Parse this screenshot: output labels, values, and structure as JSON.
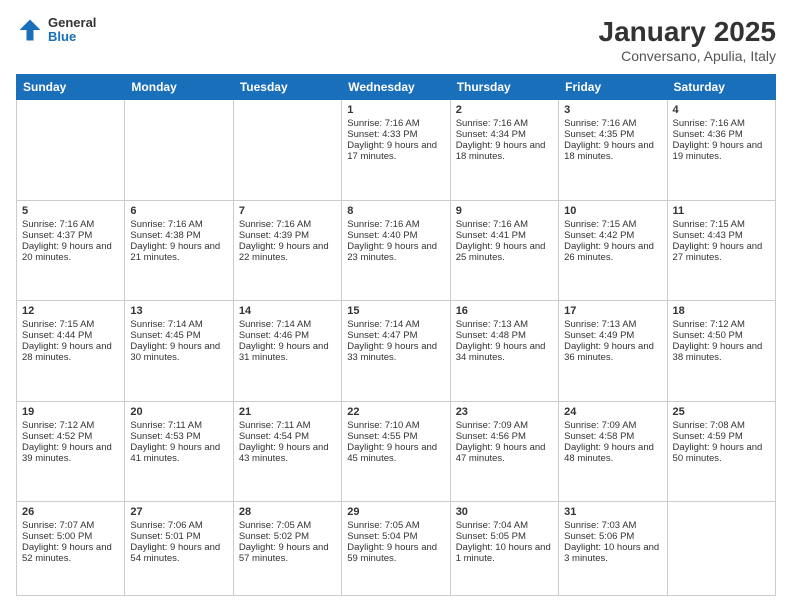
{
  "header": {
    "logo": {
      "general": "General",
      "blue": "Blue"
    },
    "title": "January 2025",
    "subtitle": "Conversano, Apulia, Italy"
  },
  "weekdays": [
    "Sunday",
    "Monday",
    "Tuesday",
    "Wednesday",
    "Thursday",
    "Friday",
    "Saturday"
  ],
  "weeks": [
    [
      {
        "day": "",
        "sunrise": "",
        "sunset": "",
        "daylight": ""
      },
      {
        "day": "",
        "sunrise": "",
        "sunset": "",
        "daylight": ""
      },
      {
        "day": "",
        "sunrise": "",
        "sunset": "",
        "daylight": ""
      },
      {
        "day": "1",
        "sunrise": "Sunrise: 7:16 AM",
        "sunset": "Sunset: 4:33 PM",
        "daylight": "Daylight: 9 hours and 17 minutes."
      },
      {
        "day": "2",
        "sunrise": "Sunrise: 7:16 AM",
        "sunset": "Sunset: 4:34 PM",
        "daylight": "Daylight: 9 hours and 18 minutes."
      },
      {
        "day": "3",
        "sunrise": "Sunrise: 7:16 AM",
        "sunset": "Sunset: 4:35 PM",
        "daylight": "Daylight: 9 hours and 18 minutes."
      },
      {
        "day": "4",
        "sunrise": "Sunrise: 7:16 AM",
        "sunset": "Sunset: 4:36 PM",
        "daylight": "Daylight: 9 hours and 19 minutes."
      }
    ],
    [
      {
        "day": "5",
        "sunrise": "Sunrise: 7:16 AM",
        "sunset": "Sunset: 4:37 PM",
        "daylight": "Daylight: 9 hours and 20 minutes."
      },
      {
        "day": "6",
        "sunrise": "Sunrise: 7:16 AM",
        "sunset": "Sunset: 4:38 PM",
        "daylight": "Daylight: 9 hours and 21 minutes."
      },
      {
        "day": "7",
        "sunrise": "Sunrise: 7:16 AM",
        "sunset": "Sunset: 4:39 PM",
        "daylight": "Daylight: 9 hours and 22 minutes."
      },
      {
        "day": "8",
        "sunrise": "Sunrise: 7:16 AM",
        "sunset": "Sunset: 4:40 PM",
        "daylight": "Daylight: 9 hours and 23 minutes."
      },
      {
        "day": "9",
        "sunrise": "Sunrise: 7:16 AM",
        "sunset": "Sunset: 4:41 PM",
        "daylight": "Daylight: 9 hours and 25 minutes."
      },
      {
        "day": "10",
        "sunrise": "Sunrise: 7:15 AM",
        "sunset": "Sunset: 4:42 PM",
        "daylight": "Daylight: 9 hours and 26 minutes."
      },
      {
        "day": "11",
        "sunrise": "Sunrise: 7:15 AM",
        "sunset": "Sunset: 4:43 PM",
        "daylight": "Daylight: 9 hours and 27 minutes."
      }
    ],
    [
      {
        "day": "12",
        "sunrise": "Sunrise: 7:15 AM",
        "sunset": "Sunset: 4:44 PM",
        "daylight": "Daylight: 9 hours and 28 minutes."
      },
      {
        "day": "13",
        "sunrise": "Sunrise: 7:14 AM",
        "sunset": "Sunset: 4:45 PM",
        "daylight": "Daylight: 9 hours and 30 minutes."
      },
      {
        "day": "14",
        "sunrise": "Sunrise: 7:14 AM",
        "sunset": "Sunset: 4:46 PM",
        "daylight": "Daylight: 9 hours and 31 minutes."
      },
      {
        "day": "15",
        "sunrise": "Sunrise: 7:14 AM",
        "sunset": "Sunset: 4:47 PM",
        "daylight": "Daylight: 9 hours and 33 minutes."
      },
      {
        "day": "16",
        "sunrise": "Sunrise: 7:13 AM",
        "sunset": "Sunset: 4:48 PM",
        "daylight": "Daylight: 9 hours and 34 minutes."
      },
      {
        "day": "17",
        "sunrise": "Sunrise: 7:13 AM",
        "sunset": "Sunset: 4:49 PM",
        "daylight": "Daylight: 9 hours and 36 minutes."
      },
      {
        "day": "18",
        "sunrise": "Sunrise: 7:12 AM",
        "sunset": "Sunset: 4:50 PM",
        "daylight": "Daylight: 9 hours and 38 minutes."
      }
    ],
    [
      {
        "day": "19",
        "sunrise": "Sunrise: 7:12 AM",
        "sunset": "Sunset: 4:52 PM",
        "daylight": "Daylight: 9 hours and 39 minutes."
      },
      {
        "day": "20",
        "sunrise": "Sunrise: 7:11 AM",
        "sunset": "Sunset: 4:53 PM",
        "daylight": "Daylight: 9 hours and 41 minutes."
      },
      {
        "day": "21",
        "sunrise": "Sunrise: 7:11 AM",
        "sunset": "Sunset: 4:54 PM",
        "daylight": "Daylight: 9 hours and 43 minutes."
      },
      {
        "day": "22",
        "sunrise": "Sunrise: 7:10 AM",
        "sunset": "Sunset: 4:55 PM",
        "daylight": "Daylight: 9 hours and 45 minutes."
      },
      {
        "day": "23",
        "sunrise": "Sunrise: 7:09 AM",
        "sunset": "Sunset: 4:56 PM",
        "daylight": "Daylight: 9 hours and 47 minutes."
      },
      {
        "day": "24",
        "sunrise": "Sunrise: 7:09 AM",
        "sunset": "Sunset: 4:58 PM",
        "daylight": "Daylight: 9 hours and 48 minutes."
      },
      {
        "day": "25",
        "sunrise": "Sunrise: 7:08 AM",
        "sunset": "Sunset: 4:59 PM",
        "daylight": "Daylight: 9 hours and 50 minutes."
      }
    ],
    [
      {
        "day": "26",
        "sunrise": "Sunrise: 7:07 AM",
        "sunset": "Sunset: 5:00 PM",
        "daylight": "Daylight: 9 hours and 52 minutes."
      },
      {
        "day": "27",
        "sunrise": "Sunrise: 7:06 AM",
        "sunset": "Sunset: 5:01 PM",
        "daylight": "Daylight: 9 hours and 54 minutes."
      },
      {
        "day": "28",
        "sunrise": "Sunrise: 7:05 AM",
        "sunset": "Sunset: 5:02 PM",
        "daylight": "Daylight: 9 hours and 57 minutes."
      },
      {
        "day": "29",
        "sunrise": "Sunrise: 7:05 AM",
        "sunset": "Sunset: 5:04 PM",
        "daylight": "Daylight: 9 hours and 59 minutes."
      },
      {
        "day": "30",
        "sunrise": "Sunrise: 7:04 AM",
        "sunset": "Sunset: 5:05 PM",
        "daylight": "Daylight: 10 hours and 1 minute."
      },
      {
        "day": "31",
        "sunrise": "Sunrise: 7:03 AM",
        "sunset": "Sunset: 5:06 PM",
        "daylight": "Daylight: 10 hours and 3 minutes."
      },
      {
        "day": "",
        "sunrise": "",
        "sunset": "",
        "daylight": ""
      }
    ]
  ]
}
